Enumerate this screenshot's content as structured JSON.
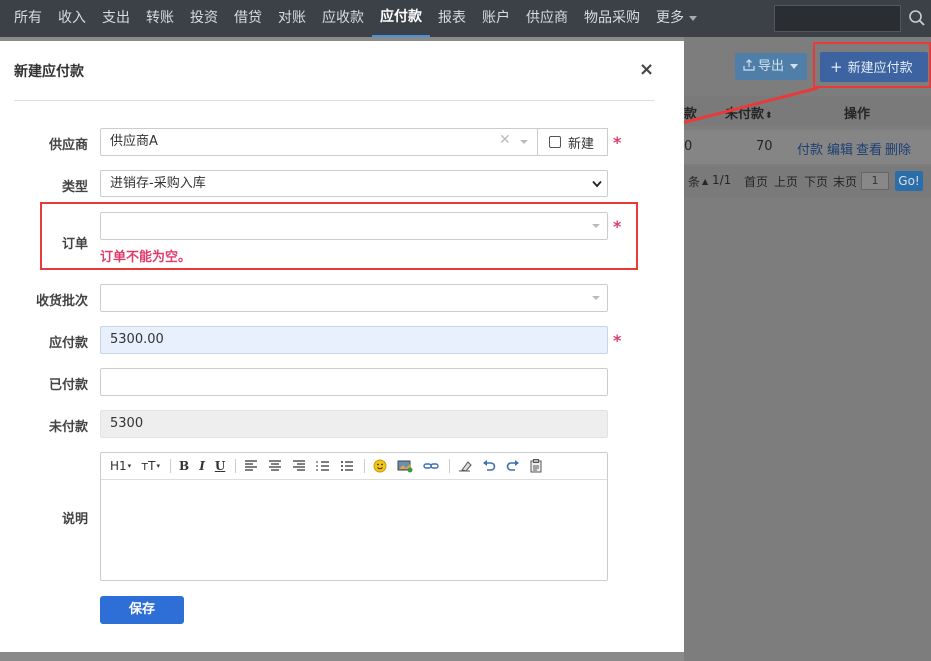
{
  "nav": {
    "items": [
      "所有",
      "收入",
      "支出",
      "转账",
      "投资",
      "借贷",
      "对账",
      "应收款",
      "应付款",
      "报表",
      "账户",
      "供应商",
      "物品采购"
    ],
    "more": "更多",
    "active_index": 8
  },
  "background": {
    "export_label": "导出",
    "new_payable_label": "新建应付款",
    "table": {
      "col_unpaid": "未付款",
      "col_ops": "操作",
      "row": {
        "left_value": "0",
        "unpaid": "70",
        "ops": [
          "付款",
          "编辑",
          "查看",
          "删除"
        ]
      }
    },
    "pager": {
      "count_suffix": "条",
      "page_info": "1/1",
      "first": "首页",
      "prev": "上页",
      "next": "下页",
      "last": "末页",
      "page_input": "1",
      "go": "Go!"
    }
  },
  "modal": {
    "title": "新建应付款",
    "close": "×",
    "fields": {
      "supplier": {
        "label": "供应商",
        "value": "供应商A",
        "new_label": "新建"
      },
      "type": {
        "label": "类型",
        "value": "进销存-采购入库"
      },
      "order": {
        "label": "订单",
        "value": "",
        "error": "订单不能为空。"
      },
      "batch": {
        "label": "收货批次",
        "value": ""
      },
      "payable": {
        "label": "应付款",
        "value": "5300.00"
      },
      "paid": {
        "label": "已付款",
        "value": ""
      },
      "unpaid": {
        "label": "未付款",
        "value": "5300"
      },
      "desc": {
        "label": "说明"
      }
    },
    "editor_toolbar": {
      "h1": "H1",
      "font_size": "тT"
    },
    "save_label": "保存"
  },
  "colors": {
    "accent": "#2d6fd6",
    "error": "#e03c6b",
    "annotation": "#e83a3a",
    "nav_bg": "#3c4148"
  }
}
